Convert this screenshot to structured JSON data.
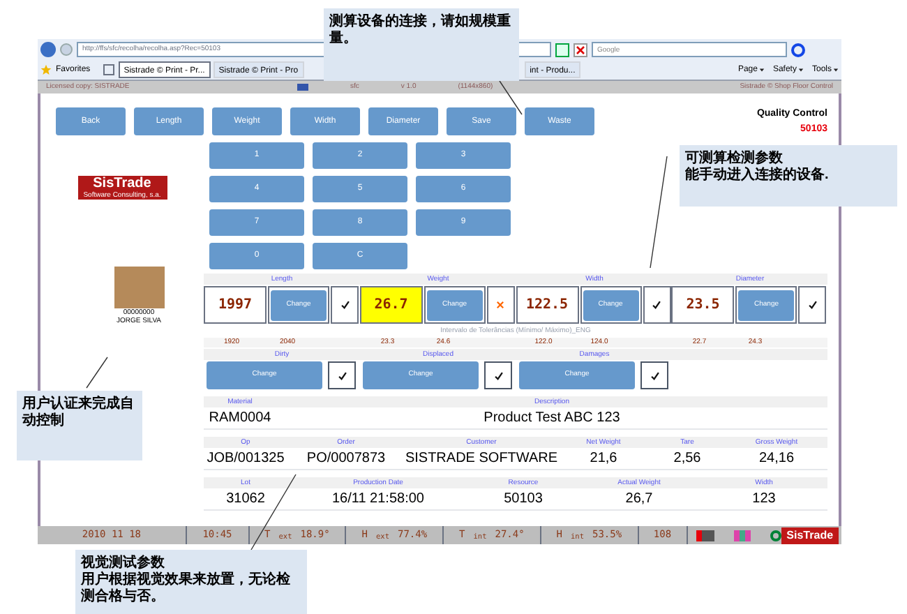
{
  "browser": {
    "address": "http://ffs/sfc/recolha/recolha.asp?Rec=50103",
    "search_placeholder": "Google",
    "favorites": "Favorites",
    "tabs": [
      {
        "label": "Sistrade © Print - Pr...",
        "selected": true
      },
      {
        "label": "Sistrade © Print - Pro",
        "selected": false
      },
      {
        "label": "int - Produ...",
        "selected": false
      }
    ],
    "toolbar": [
      "Page",
      "Safety",
      "Tools"
    ]
  },
  "app_header": {
    "license": "Licensed copy: SISTRADE",
    "module": "sfc",
    "version": "v 1.0",
    "resolution": "(1144x860)",
    "product": "Sistrade © Shop Floor Control"
  },
  "actions": [
    "Back",
    "Length",
    "Weight",
    "Width",
    "Diameter",
    "Save",
    "Waste"
  ],
  "title": "Quality Control",
  "resource_code": "50103",
  "logo": {
    "name": "SisTrade",
    "tagline": "Software Consulting, s.a."
  },
  "user": {
    "id": "00000000",
    "name": "JORGE SILVA"
  },
  "keypad": [
    "1",
    "2",
    "3",
    "4",
    "5",
    "6",
    "7",
    "8",
    "9",
    "0",
    "C"
  ],
  "measurements": [
    {
      "label": "Length",
      "value": "1997",
      "button": "Change",
      "ok": true,
      "min": "1920",
      "max": "2040"
    },
    {
      "label": "Weight",
      "value": "26.7",
      "button": "Change",
      "ok": false,
      "min": "23.3",
      "max": "24.6"
    },
    {
      "label": "Width",
      "value": "122.5",
      "button": "Change",
      "ok": true,
      "min": "122.0",
      "max": "124.0"
    },
    {
      "label": "Diameter",
      "value": "23.5",
      "button": "Change",
      "ok": true,
      "min": "22.7",
      "max": "24.3"
    }
  ],
  "tolerance_label": "Intervalo de Tolerâncias (Mínimo/ Máximo)_ENG",
  "visual_checks": [
    {
      "label": "Dirty",
      "button": "Change",
      "checked": true
    },
    {
      "label": "Displaced",
      "button": "Change",
      "checked": true
    },
    {
      "label": "Damages",
      "button": "Change",
      "checked": true
    }
  ],
  "info_rows": [
    [
      {
        "label": "Material",
        "value": "RAM0004"
      },
      {
        "label": "Description",
        "value": "Product Test ABC 123"
      }
    ],
    [
      {
        "label": "Op",
        "value": "JOB/001325"
      },
      {
        "label": "Order",
        "value": "PO/0007873"
      },
      {
        "label": "Customer",
        "value": "SISTRADE SOFTWARE"
      },
      {
        "label": "Net Weight",
        "value": "21,6"
      },
      {
        "label": "Tare",
        "value": "2,56"
      },
      {
        "label": "Gross Weight",
        "value": "24,16"
      }
    ],
    [
      {
        "label": "Lot",
        "value": "31062"
      },
      {
        "label": "Production Date",
        "value": "16/11 21:58:00"
      },
      {
        "label": "Resource",
        "value": "50103"
      },
      {
        "label": "Actual Weight",
        "value": "26,7"
      },
      {
        "label": "Width",
        "value": "123"
      }
    ]
  ],
  "status_bar": {
    "date": "2010 11 18",
    "time": "10:45",
    "readings": [
      {
        "label": "T",
        "sub": "ext",
        "value": "18.9°"
      },
      {
        "label": "H",
        "sub": "ext",
        "value": "77.4%"
      },
      {
        "label": "T",
        "sub": "int",
        "value": "27.4°"
      },
      {
        "label": "H",
        "sub": "int",
        "value": "53.5%"
      }
    ],
    "count": "108",
    "logo": "SisTrade"
  },
  "callouts": [
    {
      "lines": [
        "测算设备的连接，请如规模重",
        "量。"
      ]
    },
    {
      "lines": [
        "可测算检测参数",
        "能手动进入连接的设备."
      ]
    },
    {
      "lines": [
        "用户认证来完成自",
        "动控制"
      ]
    },
    {
      "lines": [
        "视觉测试参数",
        "用户根据视觉效果来放置，无论检",
        "测合格与否。"
      ]
    }
  ]
}
